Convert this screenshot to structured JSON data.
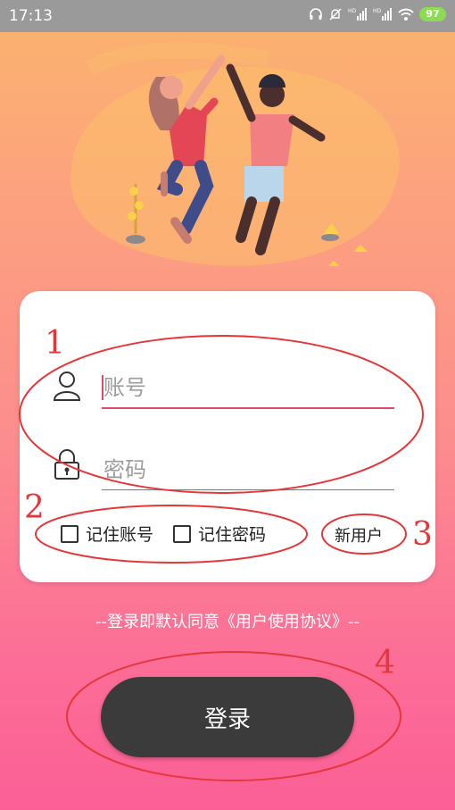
{
  "status_bar": {
    "time": "17:13",
    "signal_labels": [
      "HD",
      "HD"
    ],
    "battery": "97"
  },
  "login": {
    "account_placeholder": "账号",
    "password_placeholder": "密码",
    "remember_account": "记住账号",
    "remember_password": "记住密码",
    "new_user": "新用户",
    "agreement": "--登录即默认同意《用户使用协议》--",
    "login_button": "登录"
  },
  "annotations": [
    "1",
    "2",
    "3",
    "4"
  ],
  "colors": {
    "accent": "#e04a6a",
    "button": "#3b3b3b",
    "annotation": "#e5373a"
  }
}
